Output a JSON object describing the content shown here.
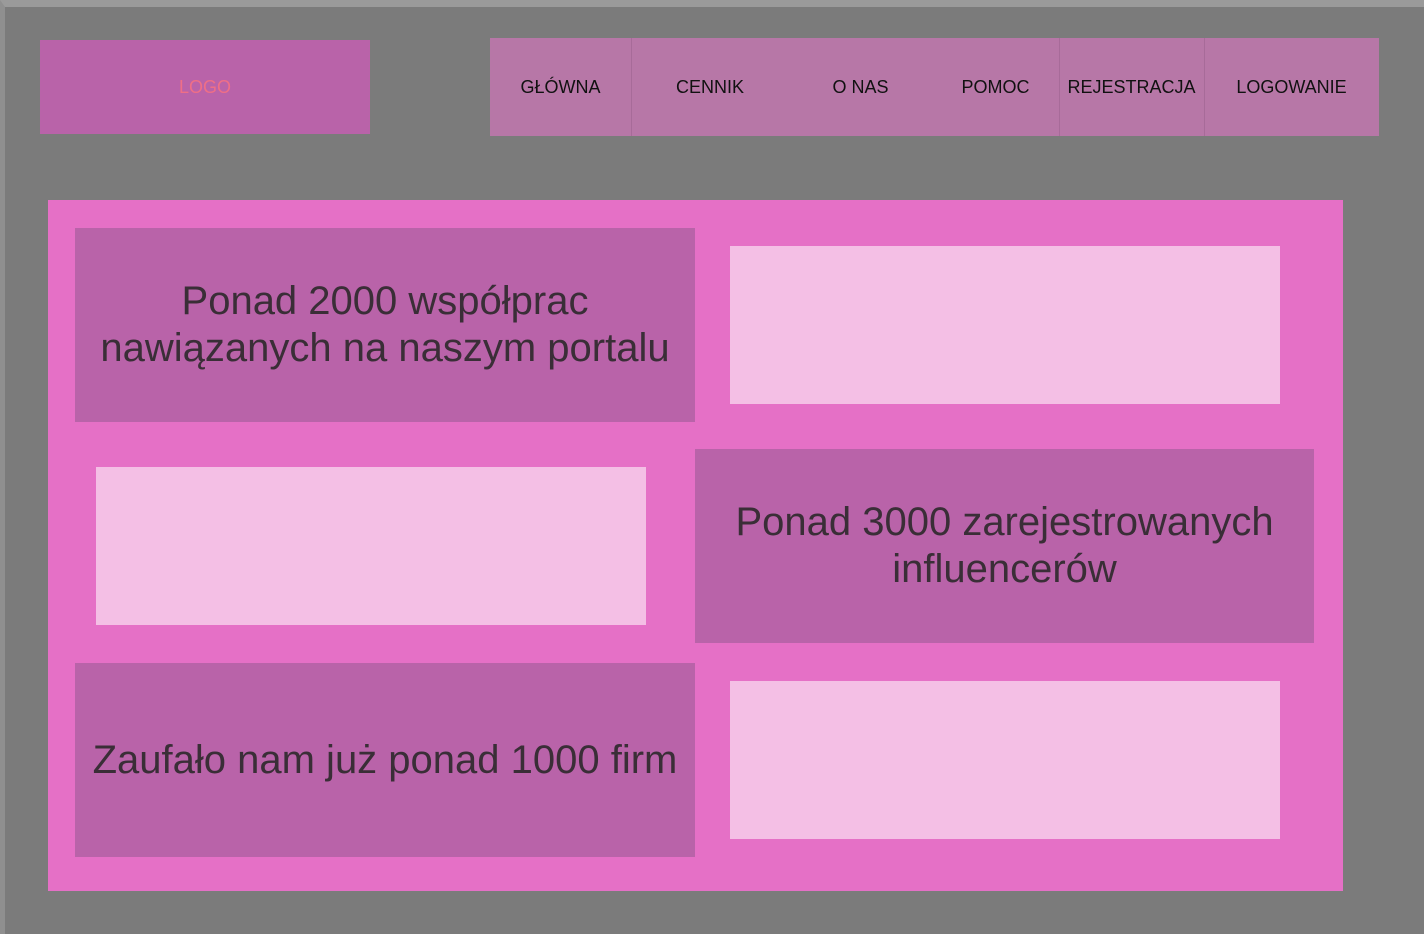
{
  "header": {
    "logo_text": "LOGO",
    "nav": [
      {
        "label": "GŁÓWNA"
      },
      {
        "label": "CENNIK"
      },
      {
        "label": "O NAS"
      },
      {
        "label": "POMOC"
      },
      {
        "label": "REJESTRACJA"
      },
      {
        "label": "LOGOWANIE"
      }
    ]
  },
  "stats": [
    {
      "text": "Ponad 2000 współprac nawiązanych na naszym portalu"
    },
    {
      "text": "Ponad 3000 zarejestrowanych influencerów"
    },
    {
      "text": "Zaufało nam już ponad 1000 firm"
    }
  ],
  "colors": {
    "background": "#7b7b7b",
    "panel": "#e570c6",
    "block": "#b963a9",
    "nav": "#b777a7",
    "placeholder": "#f4bfe5",
    "logo_text": "#ef6f86"
  }
}
